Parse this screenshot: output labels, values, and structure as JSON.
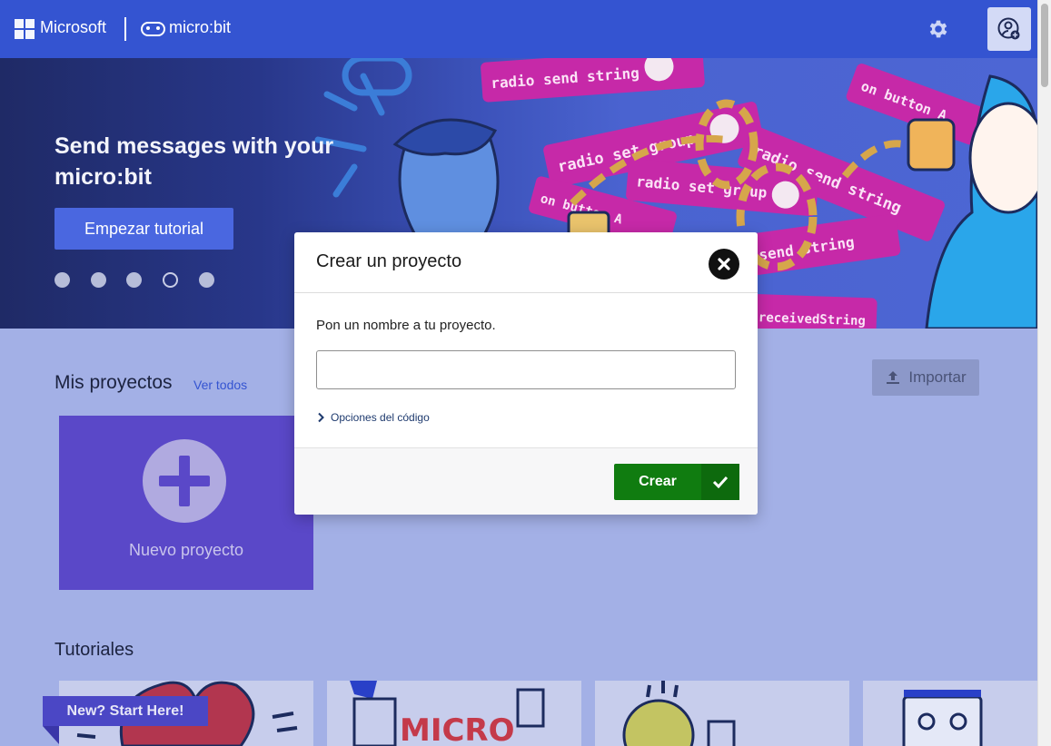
{
  "header": {
    "microsoft_label": "Microsoft",
    "product_label": "micro:bit",
    "settings_icon": "gear-icon",
    "user_icon": "user-add-icon",
    "bar_color": "#3454d1"
  },
  "hero": {
    "title": "Send messages with your micro:bit",
    "start_button": "Empezar tutorial",
    "carousel_active_index": 3,
    "carousel_count": 5,
    "art_blocks": [
      "radio send string",
      "radio set group",
      "radio send string",
      "radio set group",
      "on button A",
      "on button A",
      "receivedString",
      "send string"
    ]
  },
  "projects": {
    "title": "Mis proyectos",
    "view_all": "Ver todos",
    "import_label": "Importar",
    "new_project_label": "Nuevo proyecto"
  },
  "tutorials": {
    "title": "Tutoriales",
    "start_here": "New? Start Here!"
  },
  "modal": {
    "title": "Crear un proyecto",
    "prompt": "Pon un nombre a tu proyecto.",
    "input_value": "",
    "code_options": "Opciones del código",
    "create_label": "Crear",
    "primary_color": "#107c10"
  }
}
